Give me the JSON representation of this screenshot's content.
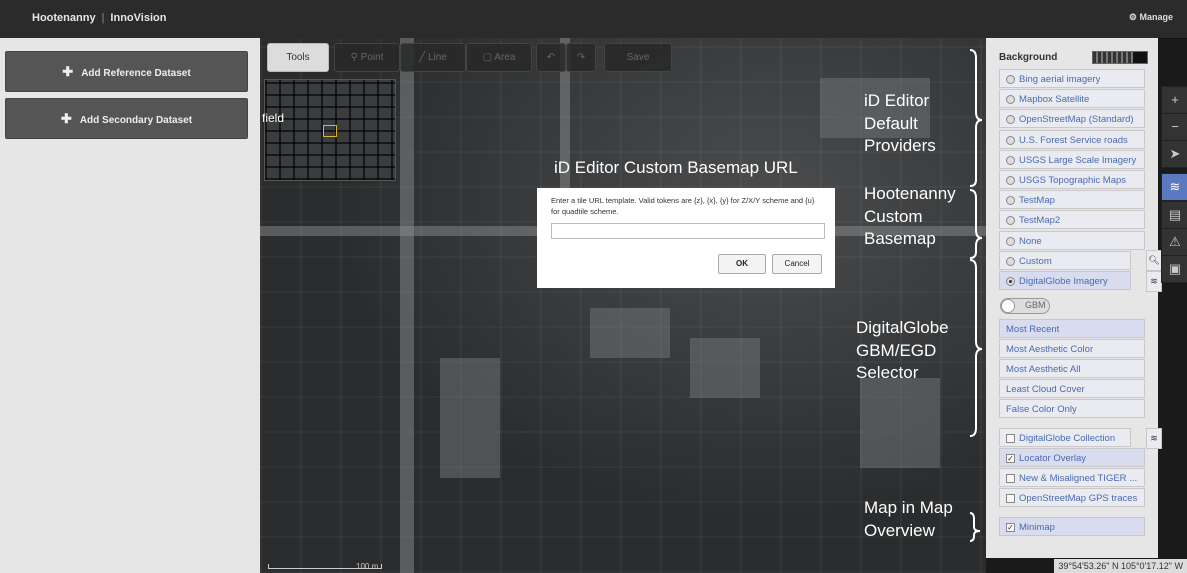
{
  "header": {
    "app": "Hootenanny",
    "org": "InnoVision",
    "manage_label": "Manage",
    "manage_icon": "gear-icon"
  },
  "datasets": [
    {
      "label": "Add Reference Dataset"
    },
    {
      "label": "Add Secondary Dataset"
    }
  ],
  "map": {
    "place_label": "field",
    "scale_label": "100 m",
    "coords": "39°54'53.26\" N 105°0'17.12\" W",
    "tools": [
      {
        "label": "Tools",
        "active": true
      },
      {
        "label": "Point"
      },
      {
        "label": "Line"
      },
      {
        "label": "Area"
      },
      {
        "label": ""
      },
      {
        "label": ""
      },
      {
        "label": "Save"
      }
    ]
  },
  "dialog": {
    "title": "iD Editor Custom Basemap URL",
    "message": "Enter a tile URL template. Valid tokens are {z}, {x}, {y} for Z/X/Y scheme and {u} for quadtile scheme.",
    "input_value": "",
    "ok_label": "OK",
    "cancel_label": "Cancel"
  },
  "background": {
    "title": "Background",
    "providers": [
      {
        "label": "Bing aerial imagery"
      },
      {
        "label": "Mapbox Satellite"
      },
      {
        "label": "OpenStreetMap (Standard)"
      },
      {
        "label": "U.S. Forest Service roads"
      },
      {
        "label": "USGS Large Scale Imagery"
      },
      {
        "label": "USGS Topographic Maps"
      },
      {
        "label": "TestMap"
      },
      {
        "label": "TestMap2"
      },
      {
        "label": "None"
      },
      {
        "label": "Custom"
      },
      {
        "label": "DigitalGlobe Imagery",
        "selected": true
      }
    ],
    "gbm_toggle_label": "GBM",
    "dg_profiles": [
      {
        "label": "Most Recent",
        "selected": true
      },
      {
        "label": "Most Aesthetic Color"
      },
      {
        "label": "Most Aesthetic All"
      },
      {
        "label": "Least Cloud Cover"
      },
      {
        "label": "False Color Only"
      }
    ],
    "overlays": [
      {
        "label": "DigitalGlobe Collection",
        "checked": false
      },
      {
        "label": "Locator Overlay",
        "checked": true
      },
      {
        "label": "New & Misaligned TIGER ...",
        "checked": false
      },
      {
        "label": "OpenStreetMap GPS traces",
        "checked": false
      }
    ],
    "minimap": {
      "label": "Minimap",
      "checked": true
    }
  },
  "annotations": {
    "default_providers": [
      "iD Editor",
      "Default",
      "Providers"
    ],
    "custom_basemap": [
      "Hootenanny",
      "Custom",
      "Basemap"
    ],
    "dg_selector": [
      "DigitalGlobe",
      "GBM/EGD",
      "Selector"
    ],
    "minimap": [
      "Map in Map",
      "Overview"
    ]
  },
  "map_controls": [
    {
      "icon": "zoom-in-icon"
    },
    {
      "icon": "zoom-out-icon"
    },
    {
      "icon": "geolocate-icon"
    },
    {
      "icon": "layers-icon"
    },
    {
      "icon": "map-data-icon"
    },
    {
      "icon": "issues-icon"
    },
    {
      "icon": "save-icon"
    }
  ]
}
